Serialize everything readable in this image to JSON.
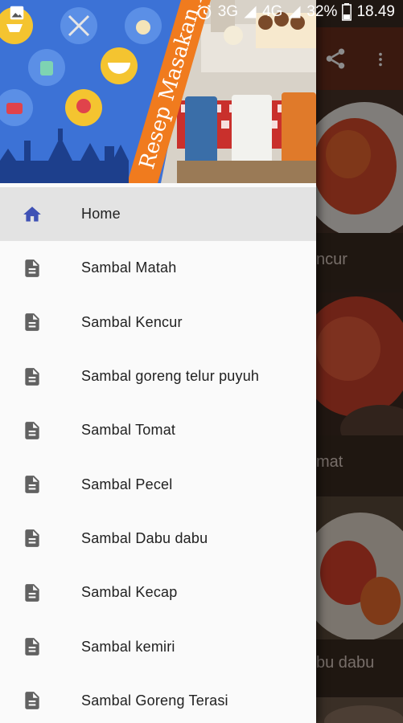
{
  "status_bar": {
    "network_3g": "3G",
    "network_4g": "4G",
    "battery": "32%",
    "time": "18.49"
  },
  "header": {
    "banner_text": "Resep Masakan Nusantara",
    "colors": {
      "blue": "#3c72d6",
      "orange": "#f07b1e",
      "icon_circle": "#5b8fe6"
    }
  },
  "drawer": {
    "items": [
      {
        "label": "Home",
        "icon": "home-icon",
        "active": true
      },
      {
        "label": "Sambal Matah",
        "icon": "document-icon"
      },
      {
        "label": "Sambal Kencur",
        "icon": "document-icon"
      },
      {
        "label": "Sambal goreng telur puyuh",
        "icon": "document-icon"
      },
      {
        "label": "Sambal Tomat",
        "icon": "document-icon"
      },
      {
        "label": "Sambal Pecel",
        "icon": "document-icon"
      },
      {
        "label": "Sambal Dabu dabu",
        "icon": "document-icon"
      },
      {
        "label": "Sambal Kecap",
        "icon": "document-icon"
      },
      {
        "label": "Sambal kemiri",
        "icon": "document-icon"
      },
      {
        "label": "Sambal Goreng Terasi",
        "icon": "document-icon"
      }
    ],
    "active_color": "#3f51b5",
    "icon_color": "#616161"
  },
  "background": {
    "toolbar_color": "#6b2f1d",
    "cards": [
      {
        "caption": "ncur"
      },
      {
        "caption": "mat"
      },
      {
        "caption": "bu dabu"
      }
    ]
  }
}
